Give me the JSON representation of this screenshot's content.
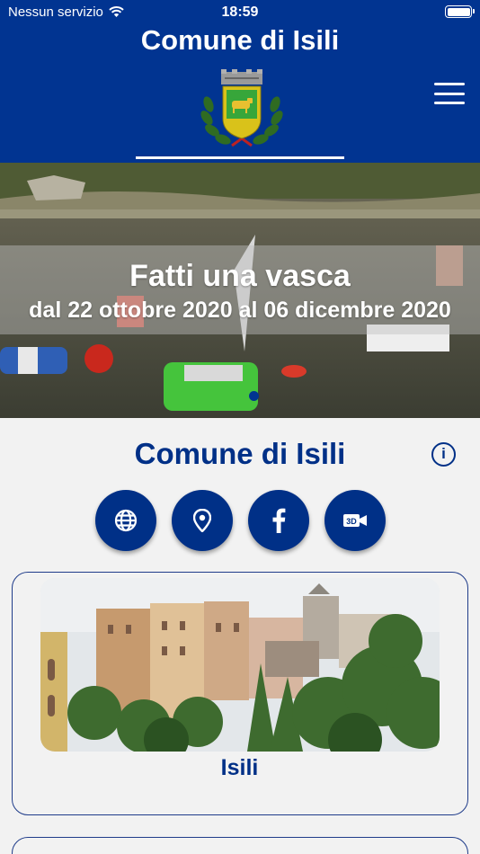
{
  "status_bar": {
    "carrier": "Nessun servizio",
    "time": "18:59",
    "wifi_icon": "wifi-icon",
    "battery_icon": "battery-icon"
  },
  "header": {
    "title": "Comune di Isili",
    "coat_of_arms": "coat-of-arms-logo",
    "menu_icon": "hamburger-menu-icon",
    "background_color": "#013491"
  },
  "banner": {
    "title": "Fatti una vasca",
    "subtitle": "dal 22 ottobre 2020 al 06 dicembre 2020",
    "slide_indicator_icon": "carousel-dot-icon"
  },
  "main": {
    "title": "Comune di Isili",
    "info_icon": "info-icon",
    "info_glyph": "i",
    "actions": [
      {
        "icon": "globe-icon",
        "name": "website"
      },
      {
        "icon": "location-pin-icon",
        "name": "map"
      },
      {
        "icon": "facebook-icon",
        "name": "facebook"
      },
      {
        "icon": "3d-video-icon",
        "name": "3d-video"
      }
    ],
    "accent_color": "#003087"
  },
  "cards": [
    {
      "label": "Isili",
      "image": "town-photo"
    }
  ]
}
